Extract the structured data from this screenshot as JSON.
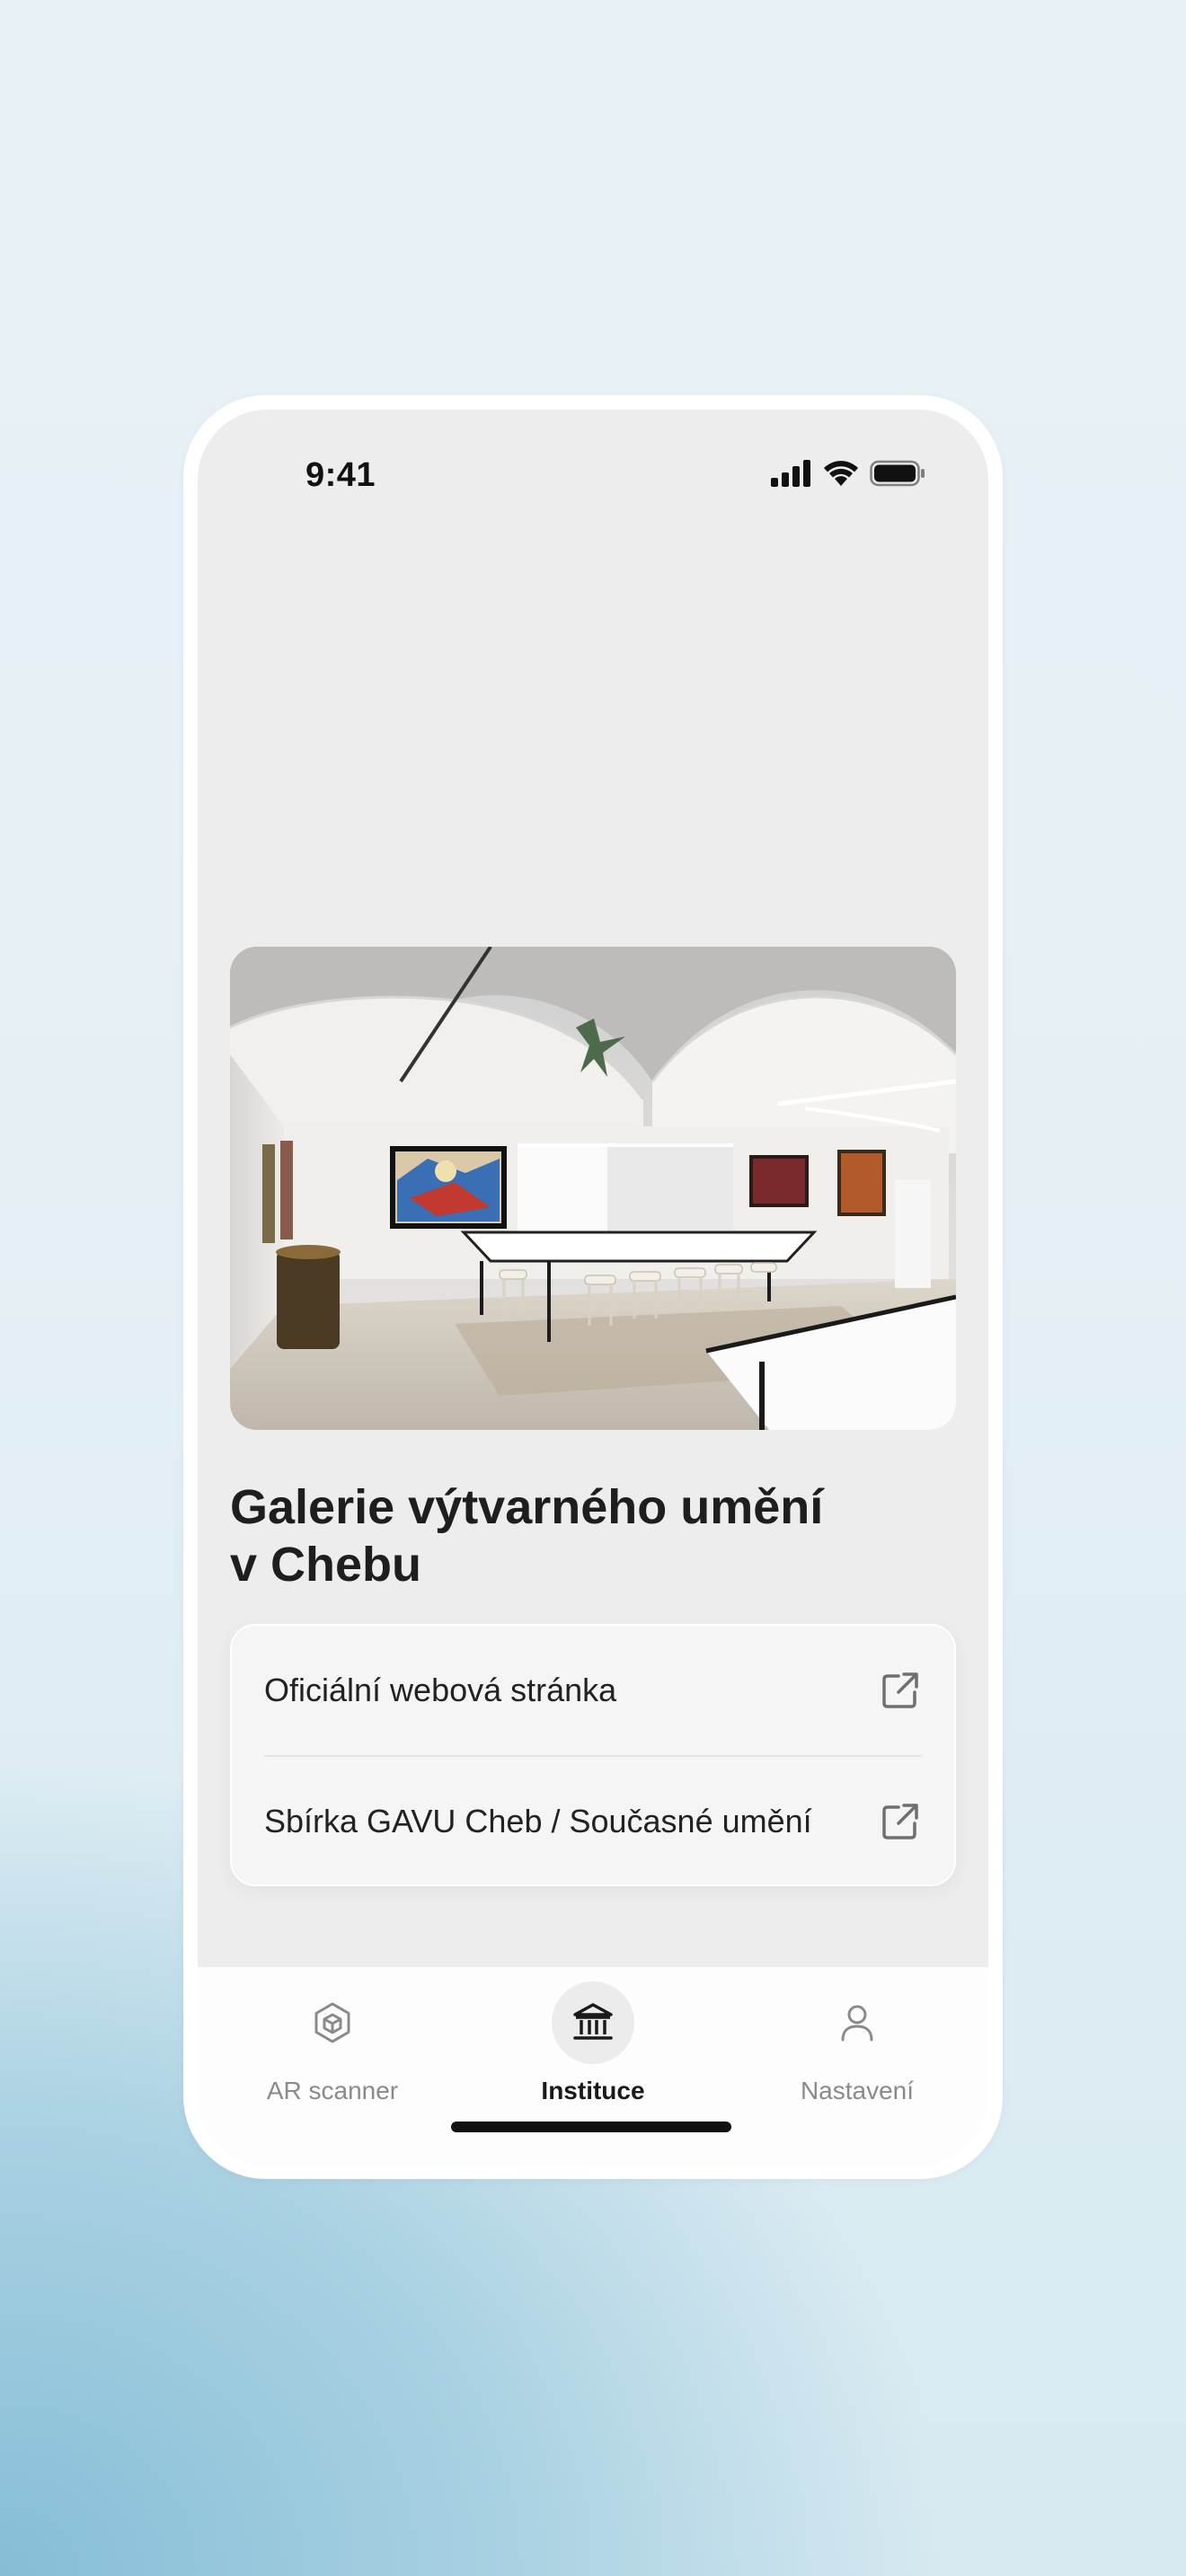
{
  "status_bar": {
    "time": "9:41"
  },
  "institution": {
    "title_line1": "Galerie výtvarného umění",
    "title_line2": "v Chebu",
    "image_description_icon": "gallery-interior-photo"
  },
  "links": [
    {
      "label": "Oficiální webová stránka",
      "icon": "external-link-icon"
    },
    {
      "label": "Sbírka GAVU Cheb / Současné umění",
      "icon": "external-link-icon"
    }
  ],
  "tab_bar": {
    "items": [
      {
        "label": "AR scanner",
        "icon": "ar-cube-icon",
        "active": false
      },
      {
        "label": "Instituce",
        "icon": "museum-icon",
        "active": true
      },
      {
        "label": "Nastavení",
        "icon": "person-icon",
        "active": false
      }
    ]
  },
  "colors": {
    "screen_bg": "#ededed",
    "card_bg": "#f5f5f5",
    "active_tab_text": "#1a1a1a",
    "inactive_tab_text": "#8a8a8a"
  }
}
